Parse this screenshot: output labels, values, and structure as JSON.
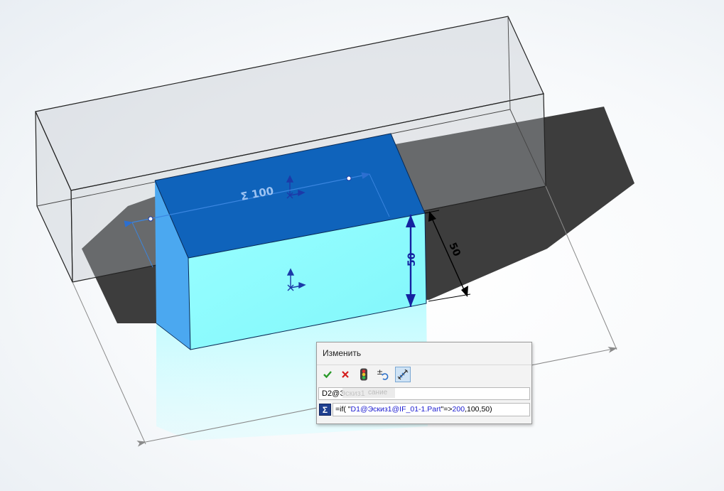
{
  "dimensions": {
    "sum_dimension": "Σ 100",
    "height_front": "50",
    "height_side": "50"
  },
  "dialog": {
    "title": "Изменить",
    "toolbar": [
      {
        "name": "ok-button",
        "icon": "checkmark-icon"
      },
      {
        "name": "cancel-button",
        "icon": "close-icon"
      },
      {
        "name": "rebuild-button",
        "icon": "traffic-light-icon"
      },
      {
        "name": "reset-spin-button",
        "icon": "plus-minus-icon"
      },
      {
        "name": "mark-dimension-button",
        "icon": "dimension-mark-icon",
        "active": true
      }
    ],
    "dimension_name": "D2@Эскиз1",
    "ghost_tooltip": "сание",
    "equation": {
      "prefix": "=if( \"",
      "dim_ref": "D1@Эскиз1@IF_01-1.Part",
      "mid": "\"=>",
      "value_true": "200",
      "sep1": ",",
      "value_a": "100",
      "sep2": ",",
      "value_b": "50",
      "suffix": ")"
    }
  },
  "colors": {
    "top_face": "#0f63bb",
    "front_face": "#8bfdfd",
    "side_face": "#47a8f2",
    "shadow": "#2a2a2a",
    "dimension_blue": "#1522a0"
  }
}
